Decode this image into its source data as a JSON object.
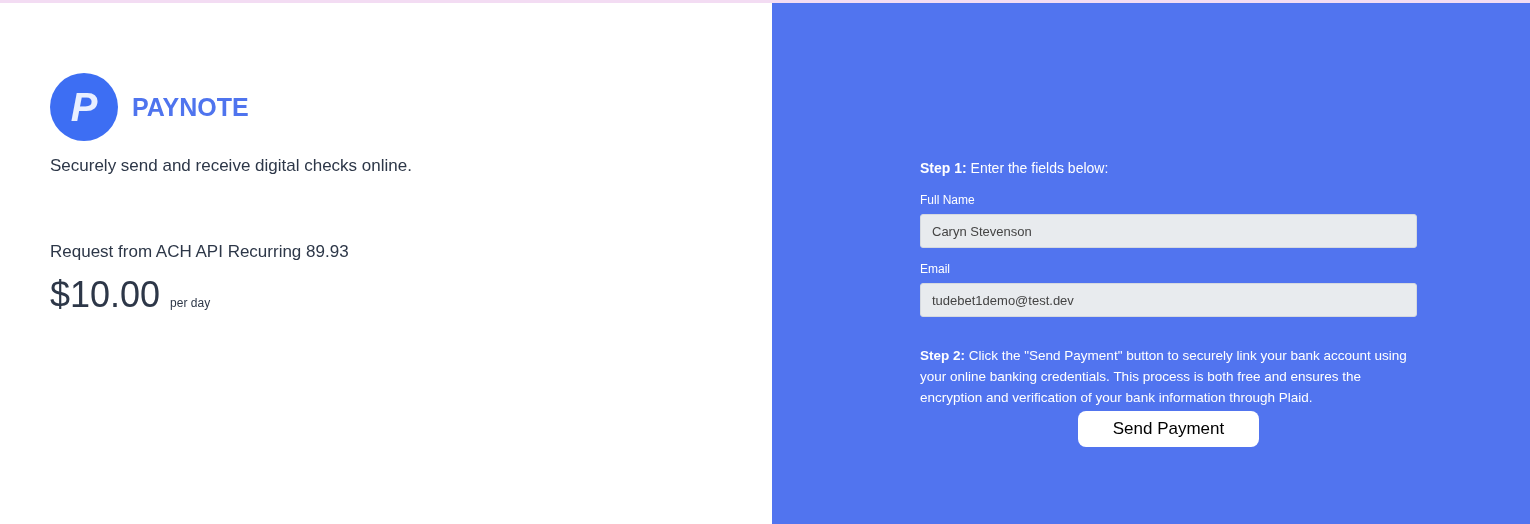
{
  "brand": {
    "logo_letter": "P",
    "name": "PAYNOTE",
    "tagline": "Securely send and receive digital checks online."
  },
  "request": {
    "title": "Request from ACH API Recurring 89.93",
    "amount": "$10.00",
    "period": "per day"
  },
  "form": {
    "step1": "**Step 1:** Enter the fields below:",
    "fields": [
      {
        "label": "Full Name",
        "value": "Caryn Stevenson"
      },
      {
        "label": "Email",
        "value": "tudebet1demo@test.dev"
      }
    ],
    "step2": "**Step 2:** Click the \"Send Payment\" button to securely link your bank account using your online banking credentials. This process is both free and ensures the encryption and verification of your bank information through Plaid.",
    "button": "Send Payment"
  }
}
